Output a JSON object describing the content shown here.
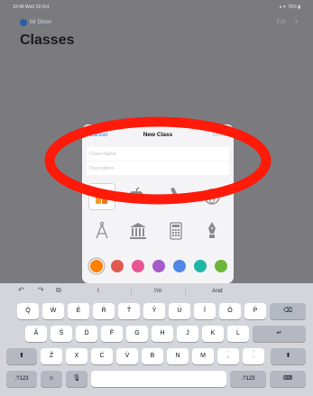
{
  "status_bar": {
    "time": "10:48 Wed 18 Oct",
    "indicators": "◂ ✦ 75% ▮"
  },
  "nav": {
    "user_name": "Mr Dixon",
    "edit_label": "Edit",
    "add_label": "+"
  },
  "page": {
    "title": "Classes"
  },
  "sheet": {
    "cancel_label": "Cancel",
    "title": "New Class",
    "done_label": "Done",
    "name_placeholder": "Class Name",
    "description_placeholder": "Description",
    "icons_row1": [
      "books-icon",
      "apple-icon",
      "microscope-icon",
      "globe-icon"
    ],
    "icons_row2": [
      "compass-icon",
      "museum-icon",
      "calculator-icon",
      "fountain-pen-icon"
    ],
    "selected_icon": "books-icon",
    "colors": [
      "#ff7f00",
      "#e05a50",
      "#e8548f",
      "#a65bcb",
      "#4f86e8",
      "#1fb8a6",
      "#6ab73c"
    ],
    "selected_color": "#ff7f00"
  },
  "annotation": {
    "color": "#ff1a0a"
  },
  "keyboard": {
    "suggestions": [
      "I",
      "I'm",
      "And"
    ],
    "row1": [
      [
        "Q",
        "1"
      ],
      [
        "W",
        "2"
      ],
      [
        "E",
        "3"
      ],
      [
        "R",
        "4"
      ],
      [
        "T",
        "5"
      ],
      [
        "Y",
        "6"
      ],
      [
        "U",
        "7"
      ],
      [
        "I",
        "8"
      ],
      [
        "O",
        "9"
      ],
      [
        "P",
        "0"
      ]
    ],
    "row2": [
      [
        "A",
        "@"
      ],
      [
        "S",
        "#"
      ],
      [
        "D",
        "£"
      ],
      [
        "F",
        "&"
      ],
      [
        "G",
        "*"
      ],
      [
        "H",
        "("
      ],
      [
        "J",
        ")"
      ],
      [
        "K",
        "'"
      ],
      [
        "L",
        "\""
      ]
    ],
    "row3": [
      [
        "Z",
        "%"
      ],
      [
        "X",
        "-"
      ],
      [
        "C",
        "+"
      ],
      [
        "V",
        "="
      ],
      [
        "B",
        "/"
      ],
      [
        "N",
        ";"
      ],
      [
        "M",
        ":"
      ],
      [
        "!",
        ","
      ],
      [
        "?",
        "."
      ]
    ],
    "numbers_label": ".?123",
    "backspace_symbol": "⌫",
    "return_symbol": "↵",
    "shift_symbol": "⬆",
    "undo_symbol": "↶",
    "redo_symbol": "↷",
    "paste_symbol": "⧉",
    "emoji_symbol": "☺",
    "mic_symbol": "🎙",
    "dismiss_symbol": "⌨"
  }
}
